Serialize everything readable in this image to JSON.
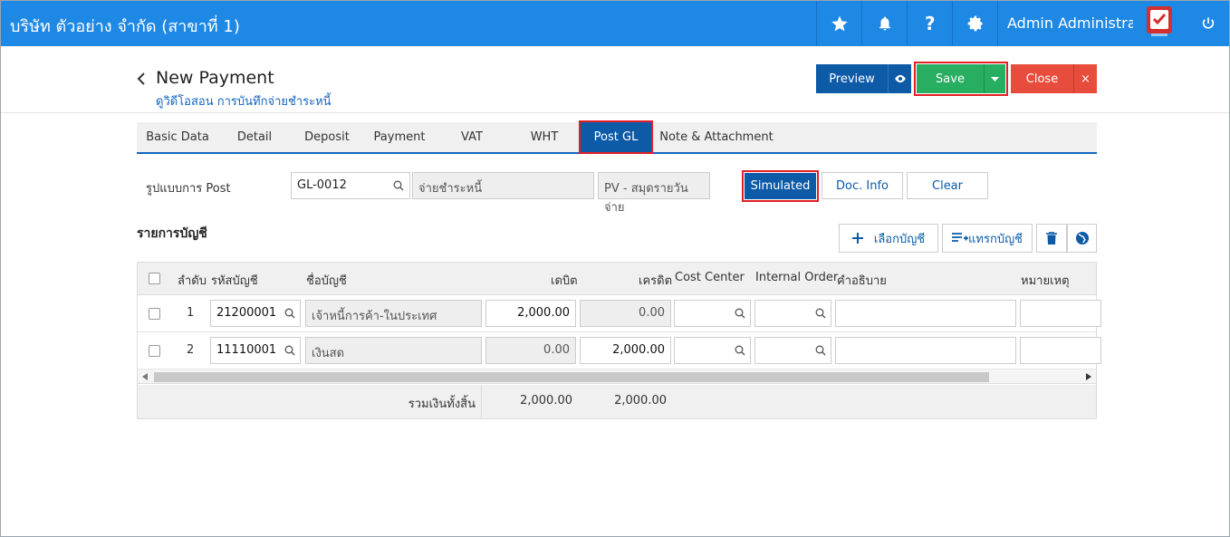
{
  "topbar": {
    "company": "บริษัท ตัวอย่าง จำกัด (สาขาที่ 1)",
    "user": "Admin Administrator",
    "icons": [
      "star-icon",
      "bell-icon",
      "help-icon",
      "gear-icon",
      "shield-check-icon",
      "power-icon"
    ],
    "color": "#1e88e5"
  },
  "header": {
    "title": "New Payment",
    "subtitle": "ดูวิดีโอสอน การบันทึกจ่ายชำระหนี้",
    "preview_label": "Preview",
    "save_label": "Save",
    "close_label": "Close",
    "close_x": "×"
  },
  "tabs": [
    {
      "label": "Basic Data"
    },
    {
      "label": "Detail"
    },
    {
      "label": "Deposit"
    },
    {
      "label": "Payment"
    },
    {
      "label": "VAT"
    },
    {
      "label": "WHT"
    },
    {
      "label": "Post GL",
      "active": true
    },
    {
      "label": "Note & Attachment"
    }
  ],
  "post": {
    "label": "รูปแบบการ Post",
    "code": "GL-0012",
    "name": "จ่ายชำระหนี้",
    "journal": "PV - สมุดรายวันจ่าย",
    "simulated_label": "Simulated",
    "docinfo_label": "Doc. Info",
    "clear_label": "Clear"
  },
  "accounts": {
    "title": "รายการบัญชี",
    "select_label": "เลือกบัญชี",
    "insert_label": "แทรกบัญชี",
    "columns": {
      "no": "ลำดับ",
      "code": "รหัสบัญชี",
      "name": "ชื่อบัญชี",
      "debit": "เดบิต",
      "credit": "เครดิต",
      "cost_center": "Cost Center",
      "internal_order": "Internal Order",
      "description": "คำอธิบาย",
      "remark": "หมายเหตุ"
    },
    "rows": [
      {
        "no": "1",
        "code": "21200001",
        "name": "เจ้าหนี้การค้า-ในประเทศ",
        "debit": "2,000.00",
        "credit": "0.00"
      },
      {
        "no": "2",
        "code": "11110001",
        "name": "เงินสด",
        "debit": "0.00",
        "credit": "2,000.00"
      }
    ],
    "total_label": "รวมเงินทั้งสิ้น",
    "total_debit": "2,000.00",
    "total_credit": "2,000.00"
  }
}
